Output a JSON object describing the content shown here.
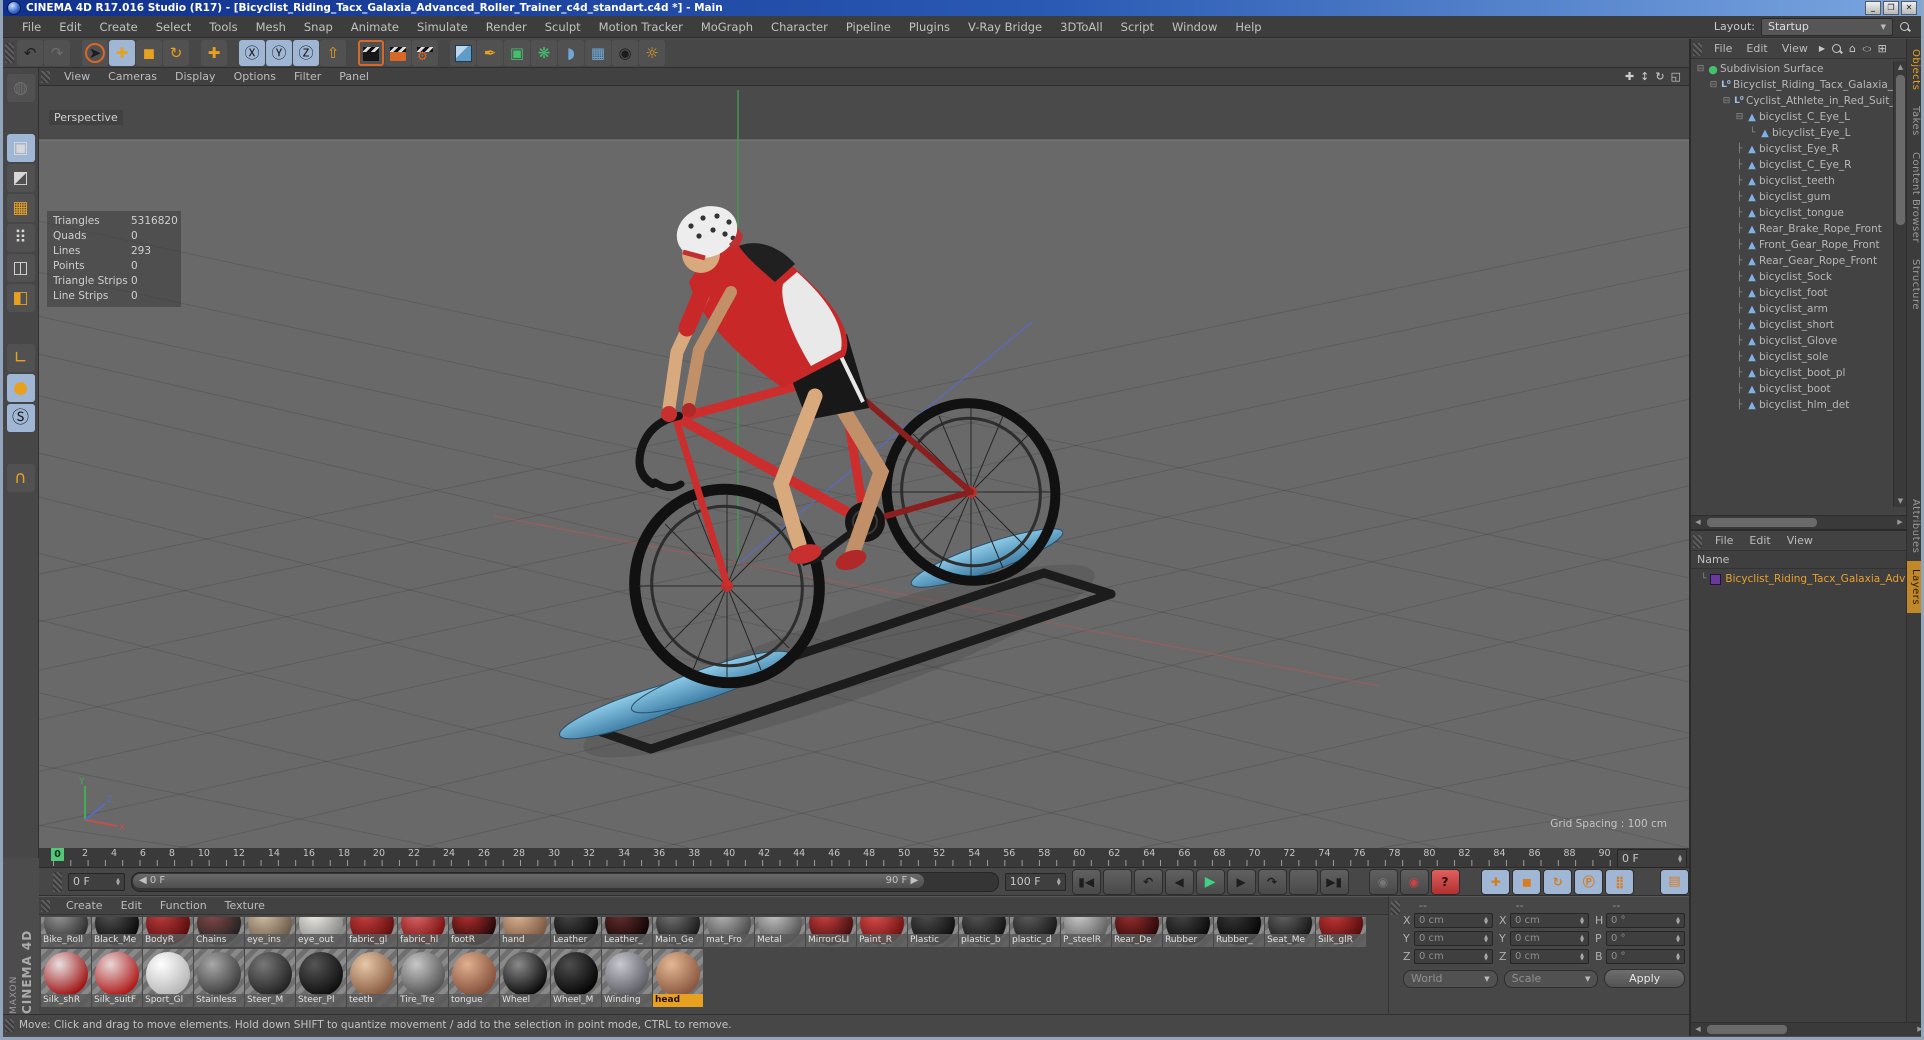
{
  "window": {
    "title": "CINEMA 4D R17.016 Studio (R17) - [Bicyclist_Riding_Tacx_Galaxia_Advanced_Roller_Trainer_c4d_standart.c4d *] - Main",
    "controls": {
      "minimize": "_",
      "maximize": "❐",
      "close": "✕"
    }
  },
  "menubar": {
    "items": [
      "File",
      "Edit",
      "Create",
      "Select",
      "Tools",
      "Mesh",
      "Snap",
      "Animate",
      "Simulate",
      "Render",
      "Sculpt",
      "Motion Tracker",
      "MoGraph",
      "Character",
      "Pipeline",
      "Plugins",
      "V-Ray Bridge",
      "3DToAll",
      "Script",
      "Window",
      "Help"
    ],
    "layout_label": "Layout:",
    "layout_value": "Startup"
  },
  "main_toolbar": {
    "items": [
      {
        "g": "↶",
        "name": "undo-button",
        "cls": "dark"
      },
      {
        "g": "↷",
        "name": "redo-button",
        "cls": "dis"
      },
      {
        "g": "",
        "name": "separator",
        "cls": "sep"
      },
      {
        "g": "➤",
        "name": "live-selection-tool",
        "cls": "dark ring"
      },
      {
        "g": "✚",
        "name": "move-tool",
        "cls": "orange sel"
      },
      {
        "g": "◼",
        "name": "scale-tool",
        "cls": "orange"
      },
      {
        "g": "↻",
        "name": "rotate-tool",
        "cls": "orange"
      },
      {
        "g": "",
        "name": "separator",
        "cls": "sep"
      },
      {
        "g": "✚",
        "name": "last-used-tool",
        "cls": "orange"
      },
      {
        "g": "",
        "name": "separator",
        "cls": "sep"
      },
      {
        "g": "Ⓧ",
        "name": "lock-x-axis",
        "cls": "dark sel"
      },
      {
        "g": "Ⓨ",
        "name": "lock-y-axis",
        "cls": "dark sel"
      },
      {
        "g": "Ⓩ",
        "name": "lock-z-axis",
        "cls": "dark sel"
      },
      {
        "g": "⇧",
        "name": "coordinate-system-toggle",
        "cls": "orange"
      },
      {
        "g": "",
        "name": "separator",
        "cls": "sep"
      },
      {
        "g": "",
        "name": "render-view-button",
        "cls": "clap selb"
      },
      {
        "g": "",
        "name": "render-to-picture-viewer-button",
        "cls": "clap pv"
      },
      {
        "g": "",
        "name": "render-settings-button",
        "cls": "clap gear"
      },
      {
        "g": "",
        "name": "separator",
        "cls": "sep"
      },
      {
        "g": "",
        "name": "add-primitive-cube-button",
        "cls": "cubebtn"
      },
      {
        "g": "✒",
        "name": "spline-pen-button",
        "cls": "orange"
      },
      {
        "g": "▣",
        "name": "subdivision-surface-button",
        "cls": "green"
      },
      {
        "g": "❋",
        "name": "mograph-button",
        "cls": "green"
      },
      {
        "g": "◗",
        "name": "deformer-button",
        "cls": "blue"
      },
      {
        "g": "▦",
        "name": "floor-environment-button",
        "cls": "blue"
      },
      {
        "g": "◉",
        "name": "camera-button",
        "cls": "dark"
      },
      {
        "g": "☼",
        "name": "light-button",
        "cls": "orange"
      }
    ]
  },
  "left_toolbar": {
    "items": [
      {
        "g": "◍",
        "name": "make-editable-button",
        "cls": "dis"
      },
      {
        "g": "",
        "name": "gap",
        "cls": "sep"
      },
      {
        "g": "▣",
        "name": "model-mode-button",
        "cls": "sel"
      },
      {
        "g": "◩",
        "name": "texture-mode-button"
      },
      {
        "g": "▦",
        "name": "workplane-mode-button",
        "cls": "orange"
      },
      {
        "g": "⠿",
        "name": "points-mode-button"
      },
      {
        "g": "◫",
        "name": "edges-mode-button"
      },
      {
        "g": "◧",
        "name": "polygons-mode-button",
        "cls": "orange"
      },
      {
        "g": "",
        "name": "gap",
        "cls": "sep"
      },
      {
        "g": "∟",
        "name": "enable-axis-button",
        "cls": "orange"
      },
      {
        "g": "●",
        "name": "viewport-solo-button",
        "cls": "orange sel"
      },
      {
        "g": "Ⓢ",
        "name": "snap-settings-button",
        "cls": "dark sel"
      },
      {
        "g": "",
        "name": "gap",
        "cls": "sep"
      },
      {
        "g": "∩",
        "name": "magnet-snap-button",
        "cls": "orange"
      }
    ]
  },
  "viewport": {
    "menu": [
      "View",
      "Cameras",
      "Display",
      "Options",
      "Filter",
      "Panel"
    ],
    "nav_icons": [
      {
        "g": "✚",
        "name": "pan-view-icon"
      },
      {
        "g": "↕",
        "name": "zoom-view-icon"
      },
      {
        "g": "↻",
        "name": "rotate-view-icon"
      },
      {
        "g": "◱",
        "name": "toggle-view-icon"
      }
    ],
    "camera_label": "Perspective",
    "stats": [
      {
        "label": "Triangles",
        "value": "5316820"
      },
      {
        "label": "Quads",
        "value": "0"
      },
      {
        "label": "Lines",
        "value": "293"
      },
      {
        "label": "Points",
        "value": "0"
      },
      {
        "label": "Triangle Strips",
        "value": "0"
      },
      {
        "label": "Line Strips",
        "value": "0"
      }
    ],
    "grid_spacing": "Grid Spacing : 100 cm"
  },
  "timeline": {
    "labels": [
      "0",
      "2",
      "4",
      "6",
      "8",
      "10",
      "12",
      "14",
      "16",
      "18",
      "20",
      "22",
      "24",
      "26",
      "28",
      "30",
      "32",
      "34",
      "36",
      "38",
      "40",
      "42",
      "44",
      "46",
      "48",
      "50",
      "52",
      "54",
      "56",
      "58",
      "60",
      "62",
      "64",
      "66",
      "68",
      "70",
      "72",
      "74",
      "76",
      "78",
      "80",
      "82",
      "84",
      "86",
      "88",
      "90"
    ],
    "playhead": "0",
    "ruler_field": "0 F",
    "current_frame": "0 F",
    "range_start": "◀ 0 F",
    "range_end": "90 F ▶",
    "end_frame": "100 F",
    "transport": [
      {
        "g": "▮◀",
        "name": "goto-start-button"
      },
      {
        "g": "",
        "name": "gap",
        "cls": "sep"
      },
      {
        "g": "↶",
        "name": "previous-key-button"
      },
      {
        "g": "◀",
        "name": "previous-frame-button"
      },
      {
        "g": "▶",
        "name": "play-button",
        "cls": "play"
      },
      {
        "g": "▶",
        "name": "next-frame-button"
      },
      {
        "g": "↷",
        "name": "next-key-button"
      },
      {
        "g": "",
        "name": "gap",
        "cls": "sep"
      },
      {
        "g": "▶▮",
        "name": "goto-end-button"
      }
    ],
    "record": [
      {
        "g": "◉",
        "name": "record-keyframe-button",
        "cls": "dis"
      },
      {
        "g": "◉",
        "name": "autokey-button",
        "cls": "rec"
      },
      {
        "g": "?",
        "name": "keyframe-selection-button",
        "cls": "q"
      }
    ],
    "key_toggles": [
      {
        "g": "✚",
        "name": "key-position-toggle",
        "cls": "kf"
      },
      {
        "g": "◼",
        "name": "key-scale-toggle",
        "cls": "kf"
      },
      {
        "g": "↻",
        "name": "key-rotation-toggle",
        "cls": "kf"
      },
      {
        "g": "Ⓟ",
        "name": "key-parameter-toggle",
        "cls": "kf"
      },
      {
        "g": "⣿",
        "name": "key-pla-toggle",
        "cls": "kf"
      }
    ],
    "film_button": {
      "g": "▤",
      "name": "timeline-window-button"
    }
  },
  "materials": {
    "menu": [
      "Create",
      "Edit",
      "Function",
      "Texture"
    ],
    "row1": [
      {
        "n": "Bike_Roll",
        "name": "material-item",
        "s": "--c1:#9a9a9a;--c2:#2e2e2e"
      },
      {
        "n": "Black_Me",
        "name": "material-item",
        "s": "--c1:#555555;--c2:#0a0a0a"
      },
      {
        "n": "BodyR",
        "name": "material-item",
        "s": "--c1:#c04040;--c2:#5a0c0c"
      },
      {
        "n": "Chains",
        "name": "material-item",
        "s": "--c1:#8a4a4a;--c2:#222222"
      },
      {
        "n": "eye_ins",
        "name": "material-item",
        "s": "--c1:#d8c2a8;--c2:#6a5a48"
      },
      {
        "n": "eye_out",
        "name": "material-item",
        "s": "--c1:#f0efe8;--c2:#888888"
      },
      {
        "n": "fabric_gl",
        "name": "material-item",
        "s": "--c1:#d04040;--c2:#600f0f"
      },
      {
        "n": "fabric_hl",
        "name": "material-item",
        "s": "--c1:#e06a6a;--c2:#7a1010"
      },
      {
        "n": "footR",
        "name": "material-item",
        "s": "--c1:#c03030;--c2:#200808"
      },
      {
        "n": "hand",
        "name": "material-item",
        "s": "--c1:#e0b896;--c2:#7a5640"
      },
      {
        "n": "Leather",
        "name": "material-item",
        "s": "--c1:#4a4a4a;--c2:#060606"
      },
      {
        "n": "Leather_",
        "name": "material-item",
        "s": "--c1:#6a3030;--c2:#100404"
      },
      {
        "n": "Main_Ge",
        "name": "material-item",
        "s": "--c1:#777777;--c2:#1a1a1a"
      },
      {
        "n": "mat_Fro",
        "name": "material-item",
        "s": "--c1:#b8b8b8;--c2:#4a4a4a"
      },
      {
        "n": "Metal",
        "name": "material-item",
        "s": "--c1:#c8c8c8;--c2:#555555"
      },
      {
        "n": "MirrorGLI",
        "name": "material-item",
        "s": "--c1:#d84040;--c2:#401010"
      },
      {
        "n": "Paint_R",
        "name": "material-item",
        "s": "--c1:#e05050;--c2:#701212"
      },
      {
        "n": "Plastic",
        "name": "material-item",
        "s": "--c1:#505050;--c2:#101010"
      },
      {
        "n": "plastic_b",
        "name": "material-item",
        "s": "--c1:#585858;--c2:#141414"
      },
      {
        "n": "plastic_d",
        "name": "material-item",
        "s": "--c1:#606060;--c2:#181818"
      },
      {
        "n": "P_steelR",
        "name": "material-item",
        "s": "--c1:#d0d0d0;--c2:#606060"
      },
      {
        "n": "Rear_De",
        "name": "material-item",
        "s": "--c1:#a03030;--c2:#2a0808"
      },
      {
        "n": "Rubber",
        "name": "material-item",
        "s": "--c1:#484848;--c2:#0a0a0a"
      },
      {
        "n": "Rubber_",
        "name": "material-item",
        "s": "--c1:#3a3a3a;--c2:#050505"
      },
      {
        "n": "Seat_Me",
        "name": "material-item",
        "s": "--c1:#666666;--c2:#161616"
      },
      {
        "n": "Silk_glR",
        "name": "material-item",
        "s": "--c1:#cc3838;--c2:#550d0d"
      }
    ],
    "row2": [
      {
        "n": "Silk_shR",
        "name": "material-item",
        "s": "--c1:#e8e0e0;--c2:#a01616"
      },
      {
        "n": "Silk_suitF",
        "name": "material-item",
        "s": "--c1:#e8d8d8;--c2:#b01c1c"
      },
      {
        "n": "Sport_Gl",
        "name": "material-item",
        "s": "--c1:#ffffff;--c2:#b8b8b8"
      },
      {
        "n": "Stainless",
        "name": "material-item",
        "s": "--c1:#a8a8a8;--c2:#3e3e3e"
      },
      {
        "n": "Steer_M",
        "name": "material-item",
        "s": "--c1:#787878;--c2:#242424"
      },
      {
        "n": "Steer_Pl",
        "name": "material-item",
        "s": "--c1:#555555;--c2:#101010"
      },
      {
        "n": "teeth",
        "name": "material-item",
        "s": "--c1:#e8c8a8;--c2:#8a5e44"
      },
      {
        "n": "Tire_Tre",
        "name": "material-item",
        "s": "--c1:#c8c8c8;--c2:#565656"
      },
      {
        "n": "tongue",
        "name": "material-item",
        "s": "--c1:#e0b090;--c2:#84503a"
      },
      {
        "n": "Wheel",
        "name": "material-item",
        "s": "--c1:#8a8a8a;--c2:#0c0c0c"
      },
      {
        "n": "Wheel_M",
        "name": "material-item",
        "s": "--c1:#4e4e4e;--c2:#060606"
      },
      {
        "n": "Winding",
        "name": "material-item",
        "s": "--c1:#c8c8d0;--c2:#5e5e66"
      },
      {
        "n": "head",
        "name": "material-item",
        "cls": "selected",
        "s": "--c1:#e4b894;--c2:#8a5840"
      }
    ]
  },
  "coordinates": {
    "headers": [
      "--",
      "--",
      "--"
    ],
    "pos": [
      {
        "l": "X",
        "v": "0 cm"
      },
      {
        "l": "Y",
        "v": "0 cm"
      },
      {
        "l": "Z",
        "v": "0 cm"
      }
    ],
    "size": [
      {
        "l": "X",
        "v": "0 cm"
      },
      {
        "l": "Y",
        "v": "0 cm"
      },
      {
        "l": "Z",
        "v": "0 cm"
      }
    ],
    "rot": [
      {
        "l": "H",
        "v": "0 °"
      },
      {
        "l": "P",
        "v": "0 °"
      },
      {
        "l": "B",
        "v": "0 °"
      }
    ],
    "mode1": "World",
    "mode2": "Scale",
    "apply_label": "Apply"
  },
  "object_manager": {
    "menu": [
      "File",
      "Edit",
      "View"
    ],
    "tabs": [
      {
        "t": "Objects",
        "name": "tab-objects",
        "cls": "selorange"
      },
      {
        "t": "Takes",
        "name": "tab-takes"
      },
      {
        "t": "Content Browser",
        "name": "tab-content-browser"
      },
      {
        "t": "Structure",
        "name": "tab-structure"
      }
    ],
    "tree": [
      {
        "p": "⊟",
        "g": "●",
        "cls": "ico-sds",
        "t": "Subdivision Surface",
        "lv": 0,
        "name": "tree-item"
      },
      {
        "p": "⊟",
        "g": "L⁰",
        "cls": "ico-null",
        "t": "Bicyclist_Riding_Tacx_Galaxia_A",
        "lv": 1,
        "name": "tree-item"
      },
      {
        "p": "⊟",
        "g": "L⁰",
        "cls": "ico-null",
        "t": "Cyclist_Athlete_in_Red_Suit_",
        "lv": 2,
        "name": "tree-item"
      },
      {
        "p": "⊟",
        "g": "▲",
        "cls": "ico-poly",
        "t": "bicyclist_C_Eye_L",
        "lv": 3,
        "name": "tree-item"
      },
      {
        "p": "└",
        "g": "▲",
        "cls": "ico-poly",
        "t": "bicyclist_Eye_L",
        "lv": 4,
        "name": "tree-item"
      },
      {
        "p": "├",
        "g": "▲",
        "cls": "ico-poly",
        "t": "bicyclist_Eye_R",
        "lv": 3,
        "name": "tree-item"
      },
      {
        "p": "├",
        "g": "▲",
        "cls": "ico-poly",
        "t": "bicyclist_C_Eye_R",
        "lv": 3,
        "name": "tree-item"
      },
      {
        "p": "├",
        "g": "▲",
        "cls": "ico-poly",
        "t": "bicyclist_teeth",
        "lv": 3,
        "name": "tree-item"
      },
      {
        "p": "├",
        "g": "▲",
        "cls": "ico-poly",
        "t": "bicyclist_gum",
        "lv": 3,
        "name": "tree-item"
      },
      {
        "p": "├",
        "g": "▲",
        "cls": "ico-poly",
        "t": "bicyclist_tongue",
        "lv": 3,
        "name": "tree-item"
      },
      {
        "p": "├",
        "g": "▲",
        "cls": "ico-poly",
        "t": "Rear_Brake_Rope_Front",
        "lv": 3,
        "name": "tree-item"
      },
      {
        "p": "├",
        "g": "▲",
        "cls": "ico-poly",
        "t": "Front_Gear_Rope_Front",
        "lv": 3,
        "name": "tree-item"
      },
      {
        "p": "├",
        "g": "▲",
        "cls": "ico-poly",
        "t": "Rear_Gear_Rope_Front",
        "lv": 3,
        "name": "tree-item"
      },
      {
        "p": "├",
        "g": "▲",
        "cls": "ico-poly",
        "t": "bicyclist_Sock",
        "lv": 3,
        "name": "tree-item"
      },
      {
        "p": "├",
        "g": "▲",
        "cls": "ico-poly",
        "t": "bicyclist_foot",
        "lv": 3,
        "name": "tree-item"
      },
      {
        "p": "├",
        "g": "▲",
        "cls": "ico-poly",
        "t": "bicyclist_arm",
        "lv": 3,
        "name": "tree-item"
      },
      {
        "p": "├",
        "g": "▲",
        "cls": "ico-poly",
        "t": "bicyclist_short",
        "lv": 3,
        "name": "tree-item"
      },
      {
        "p": "├",
        "g": "▲",
        "cls": "ico-poly",
        "t": "bicyclist_Glove",
        "lv": 3,
        "name": "tree-item"
      },
      {
        "p": "├",
        "g": "▲",
        "cls": "ico-poly",
        "t": "bicyclist_sole",
        "lv": 3,
        "name": "tree-item"
      },
      {
        "p": "├",
        "g": "▲",
        "cls": "ico-poly",
        "t": "bicyclist_boot_pl",
        "lv": 3,
        "name": "tree-item"
      },
      {
        "p": "├",
        "g": "▲",
        "cls": "ico-poly",
        "t": "bicyclist_boot",
        "lv": 3,
        "name": "tree-item"
      },
      {
        "p": "├",
        "g": "▲",
        "cls": "ico-poly",
        "t": "bicyclist_hlm_det",
        "lv": 3,
        "name": "tree-item"
      }
    ]
  },
  "attributes_panel": {
    "menu": [
      "File",
      "Edit",
      "View"
    ],
    "column_header": "Name",
    "item_prefix": "└",
    "item": "Bicyclist_Riding_Tacx_Galaxia_Adva",
    "tabs": [
      {
        "t": "Attributes",
        "name": "tab-attributes"
      },
      {
        "t": "Layers",
        "name": "tab-layers",
        "cls": "layersel"
      }
    ]
  },
  "status_bar": {
    "text": "Move: Click and drag to move elements. Hold down SHIFT to quantize movement / add to the selection in point mode, CTRL to remove."
  },
  "branding": {
    "maxon": "MAXON",
    "cinema": "CINEMA 4D"
  }
}
